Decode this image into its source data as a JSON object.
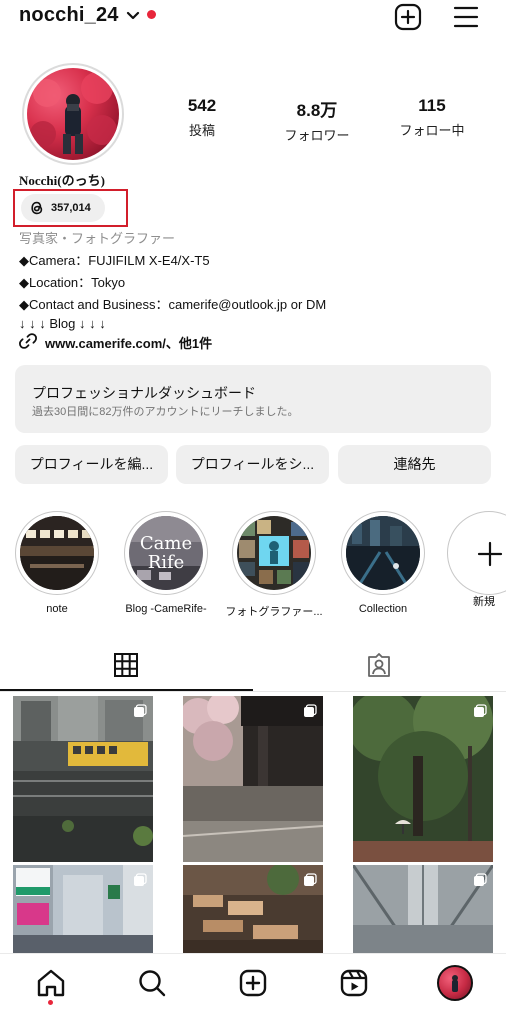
{
  "header": {
    "username": "nocchi_24",
    "icons": {
      "chevron": "chevron-down-icon",
      "notification": "red-dot",
      "create": "plus-square-icon",
      "menu": "hamburger-menu-icon"
    }
  },
  "profile": {
    "stats": [
      {
        "value": "542",
        "label": "投稿"
      },
      {
        "value": "8.8万",
        "label": "フォロワー"
      },
      {
        "value": "115",
        "label": "フォロー中"
      }
    ],
    "display_name": "Nocchi(のっち)",
    "threads_count": "357,014",
    "bio": {
      "category": "写真家・フォトグラファー",
      "lines": [
        "◆Camera：FUJIFILM X-E4/X-T5",
        "◆Location：Tokyo",
        "◆Contact and Business：camerife@outlook.jp or DM",
        "↓ ↓ ↓ Blog ↓ ↓ ↓"
      ],
      "link": "www.camerife.com/、他1件"
    },
    "accent_color": "#d21e2b"
  },
  "dashboard": {
    "title": "プロフェッショナルダッシュボード",
    "subtitle": "過去30日間に82万件のアカウントにリーチしました。"
  },
  "actions": {
    "edit": "プロフィールを編...",
    "share": "プロフィールをシ...",
    "contact": "連絡先"
  },
  "highlights": [
    {
      "label": "note"
    },
    {
      "label": "Blog -CameRife-",
      "overlay_text": "Came\nRife"
    },
    {
      "label": "フォトグラファー..."
    },
    {
      "label": "Collection"
    }
  ],
  "new_highlight": {
    "label": "新規"
  },
  "tabs": [
    {
      "name": "grid",
      "icon": "grid-icon",
      "active": true
    },
    {
      "name": "tagged",
      "icon": "tagged-person-icon",
      "active": false
    }
  ],
  "posts": [
    {
      "subject": "yellow train and buildings"
    },
    {
      "subject": "cherry blossoms under overpass"
    },
    {
      "subject": "green forest with umbrella"
    },
    {
      "subject": "city signboards"
    },
    {
      "subject": "wooden shrine decoration"
    },
    {
      "subject": "station ceiling architecture"
    }
  ],
  "bottom_nav": [
    {
      "name": "home",
      "icon": "home-icon"
    },
    {
      "name": "search",
      "icon": "search-icon"
    },
    {
      "name": "create",
      "icon": "plus-square-icon"
    },
    {
      "name": "reels",
      "icon": "reels-icon"
    },
    {
      "name": "profile",
      "icon": "avatar"
    }
  ]
}
